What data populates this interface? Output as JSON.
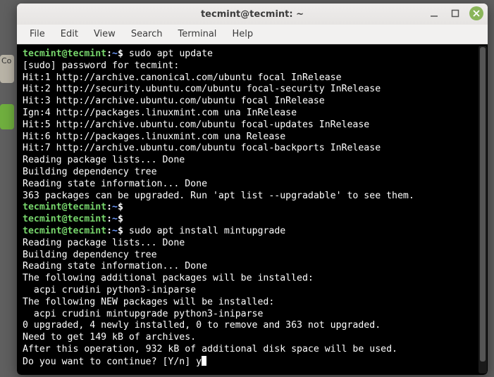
{
  "window": {
    "title": "tecmint@tecmint: ~"
  },
  "menu": {
    "items": [
      "File",
      "Edit",
      "View",
      "Search",
      "Terminal",
      "Help"
    ]
  },
  "prompt": {
    "user_host": "tecmint@tecmint",
    "colon": ":",
    "path": "~",
    "sigil": "$"
  },
  "session": {
    "cmd1": "sudo apt update",
    "sudo_prompt": "[sudo] password for tecmint:",
    "out1": [
      "Hit:1 http://archive.canonical.com/ubuntu focal InRelease",
      "Hit:2 http://security.ubuntu.com/ubuntu focal-security InRelease",
      "Hit:3 http://archive.ubuntu.com/ubuntu focal InRelease",
      "Ign:4 http://packages.linuxmint.com una InRelease",
      "Hit:5 http://archive.ubuntu.com/ubuntu focal-updates InRelease",
      "Hit:6 http://packages.linuxmint.com una Release",
      "Hit:7 http://archive.ubuntu.com/ubuntu focal-backports InRelease",
      "Reading package lists... Done",
      "Building dependency tree",
      "Reading state information... Done",
      "363 packages can be upgraded. Run 'apt list --upgradable' to see them."
    ],
    "cmd2": "",
    "cmd3": "",
    "cmd4": "sudo apt install mintupgrade",
    "out2": [
      "Reading package lists... Done",
      "Building dependency tree",
      "Reading state information... Done",
      "The following additional packages will be installed:",
      "  acpi crudini python3-iniparse",
      "The following NEW packages will be installed:",
      "  acpi crudini mintupgrade python3-iniparse",
      "0 upgraded, 4 newly installed, 0 to remove and 363 not upgraded.",
      "Need to get 149 kB of archives.",
      "After this operation, 932 kB of additional disk space will be used."
    ],
    "confirm_prompt": "Do you want to continue? [Y/n] ",
    "confirm_input": "y"
  }
}
